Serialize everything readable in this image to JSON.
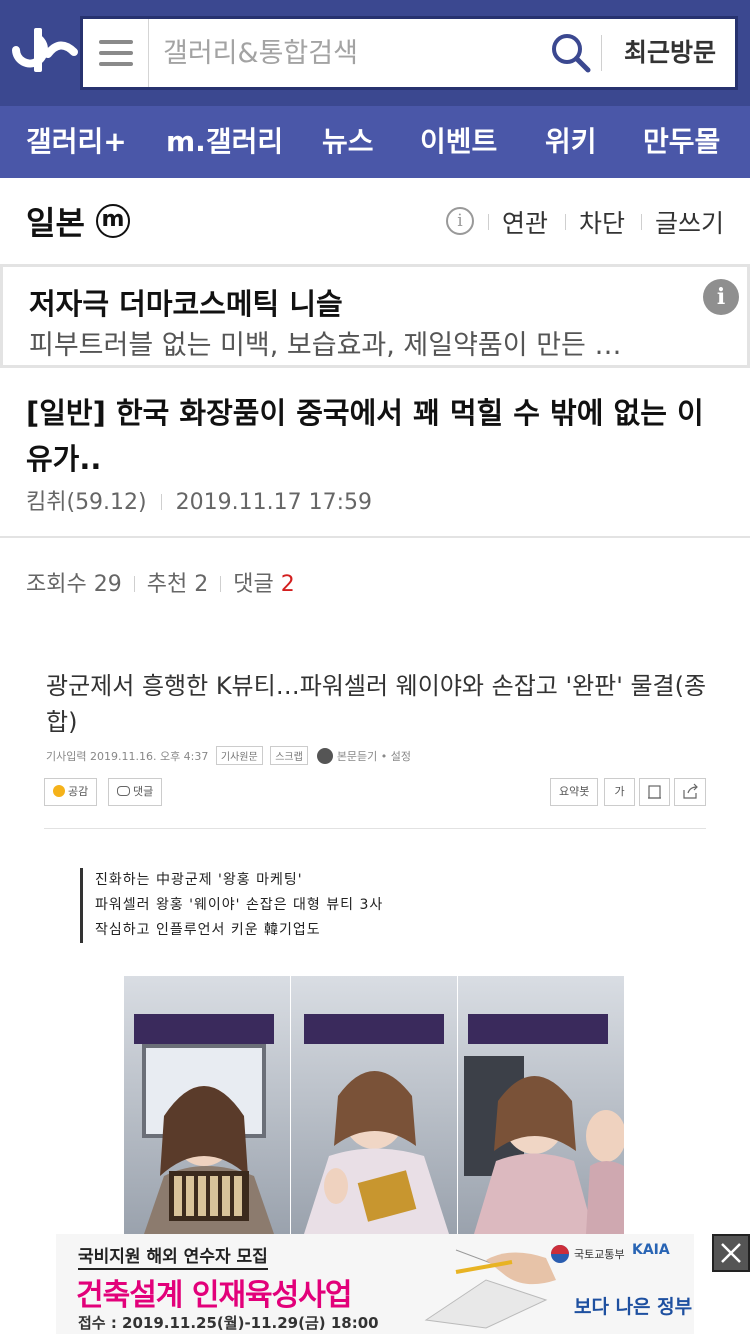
{
  "header": {
    "search_placeholder": "갤러리&통합검색",
    "recent_label": "최근방문"
  },
  "nav": {
    "items": [
      {
        "label": "갤러리+"
      },
      {
        "label": "m.갤러리"
      },
      {
        "label": "뉴스"
      },
      {
        "label": "이벤트"
      },
      {
        "label": "위키"
      },
      {
        "label": "만두몰"
      }
    ]
  },
  "gallery": {
    "name": "일본",
    "badge": "m",
    "actions": [
      "연관",
      "차단",
      "글쓰기"
    ]
  },
  "ad": {
    "title": "저자극 더마코스메틱 니슬",
    "description": "피부트러블 없는 미백, 보습효과, 제일약품이 만든 …"
  },
  "post": {
    "title": "[일반] 한국 화장품이 중국에서 꽤 먹힐 수 밖에 없는 이유가..",
    "author": "킴취(59.12)",
    "datetime": "2019.11.17 17:59",
    "views_label": "조회수",
    "views": "29",
    "recommend_label": "추천",
    "recommend": "2",
    "comments_label": "댓글",
    "comments": "2"
  },
  "news": {
    "headline": "광군제서 흥행한 K뷰티…파워셀러 웨이야와 손잡고 '완판' 물결(종합)",
    "meta_date": "기사입력 2019.11.16. 오후 4:37",
    "tag_original": "기사원문",
    "tag_scrap": "스크랩",
    "listen": "본문듣기 • 설정",
    "like": "공감",
    "reply": "댓글",
    "summary": "요약봇",
    "font": "가",
    "subheads": [
      "진화하는 中광군제 '왕홍 마케팅'",
      "파워셀러 왕홍 '웨이야' 손잡은 대형 뷰티 3사",
      "작심하고 인플루언서 키운 韓기업도"
    ]
  },
  "bottom_ad": {
    "top": "국비지원 해외 연수자 모집",
    "headline": "건축설계 인재육성사업",
    "date": "접수 : 2019.11.25(월)-11.29(금) 18:00",
    "ministry": "국토교통부",
    "kaia": "KAIA",
    "slogan": "보다 나은 정부"
  }
}
